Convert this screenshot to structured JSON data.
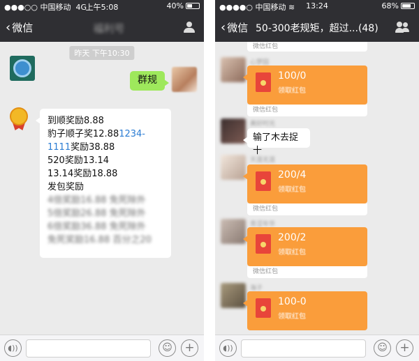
{
  "left": {
    "status": {
      "signal": "●●●○○",
      "carrier": "中国移动",
      "network": "4G",
      "time": "上午5:08",
      "battery": "40%",
      "battery_level": 0.4
    },
    "nav": {
      "back_label": "微信",
      "title": "福利号"
    },
    "timestamp": "昨天 下午10:30",
    "outgoing_message": "群规",
    "rules": {
      "line1": "到顺奖励8.88",
      "line2_prefix": "豹子顺子奖12.88",
      "line2_link": "1234-",
      "line3_link": "1111",
      "line3_suffix": "奖励38.88",
      "line4": "520奖励13.14",
      "line5": "13.14奖励18.88",
      "line6": "发包奖励",
      "blurred": [
        "4倍奖励16.88  免死除外",
        "5倍奖励26.88  免死除外",
        "6倍奖励36.88  免死除外",
        "免死奖励16.88  百分之20"
      ]
    }
  },
  "right": {
    "status": {
      "signal": "●●●●○",
      "carrier": "中国移动",
      "time": "13:24",
      "battery": "68%",
      "battery_level": 0.68
    },
    "nav": {
      "back_label": "微信",
      "title": "50-300老规矩，超过...(48)"
    },
    "packet_label": "微信红包",
    "packet_sub": "领取红包",
    "messages": [
      {
        "sender": "心梦园",
        "amount": "100/0"
      },
      {
        "sender": "美好时光",
        "text": "输了木去捉十"
      },
      {
        "sender": "天涯无涯",
        "amount": "200/4"
      },
      {
        "sender": "青涩年华",
        "amount": "200/2"
      },
      {
        "sender": "海子",
        "amount": "100-0"
      }
    ]
  },
  "icons": {
    "voice": "voice-icon",
    "emoji": "emoji-icon",
    "plus": "plus-icon",
    "contact": "contact-icon",
    "back": "chevron-left-icon"
  },
  "colors": {
    "navbar": "#2f2f33",
    "chat_bg": "#ebebeb",
    "green_bubble": "#9ee85c",
    "red_packet": "#fa9d3b",
    "link": "#2b7cd3"
  }
}
